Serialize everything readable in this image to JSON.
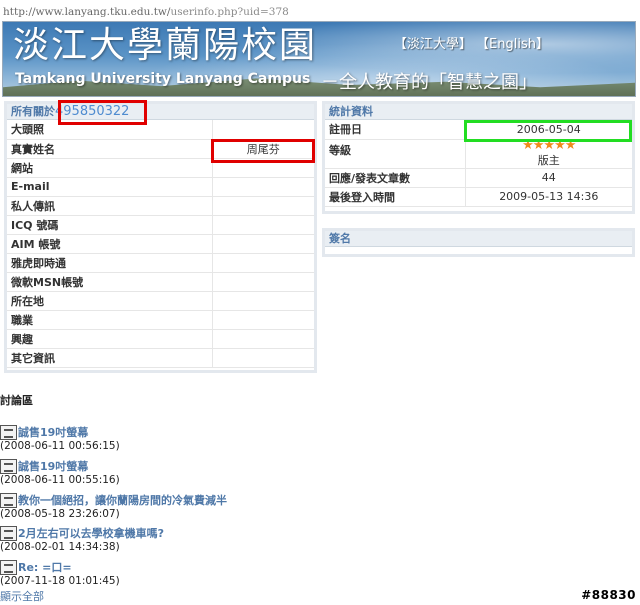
{
  "url": {
    "host": "http://www.lanyang.tku.edu.tw/",
    "path": "userinfo.php?uid=378"
  },
  "banner": {
    "title_zh": "淡江大學蘭陽校園",
    "title_en": "Tamkang University Lanyang Campus",
    "slogan": " －全人教育的「智慧之園」",
    "lang_zh": "【淡江大學】",
    "lang_en": "【English】"
  },
  "profile": {
    "header_prefix": "所有關於",
    "uid": "495850322",
    "rows": [
      {
        "label": "大頭照",
        "value": ""
      },
      {
        "label": "真實姓名",
        "value": "周尾芬"
      },
      {
        "label": "網站",
        "value": ""
      },
      {
        "label": "E-mail",
        "value": ""
      },
      {
        "label": "私人傳訊",
        "value": ""
      },
      {
        "label": "ICQ 號碼",
        "value": ""
      },
      {
        "label": "AIM 帳號",
        "value": ""
      },
      {
        "label": "雅虎即時通",
        "value": ""
      },
      {
        "label": "微軟MSN帳號",
        "value": ""
      },
      {
        "label": "所在地",
        "value": ""
      },
      {
        "label": "職業",
        "value": ""
      },
      {
        "label": "興趣",
        "value": ""
      },
      {
        "label": "其它資訊",
        "value": ""
      }
    ]
  },
  "stats": {
    "header": "統計資料",
    "register_label": "註冊日",
    "register_value": "2006-05-04",
    "rank_label": "等級",
    "rank_stars": "★★★★★",
    "rank_value": "版主",
    "posts_label": "回應/發表文章數",
    "posts_value": "44",
    "last_login_label": "最後登入時間",
    "last_login_value": "2009-05-13 14:36"
  },
  "signature": {
    "header": "簽名"
  },
  "discussion": {
    "title": "討論區",
    "topics": [
      {
        "title": "誠售19吋螢幕",
        "date": "(2008-06-11 00:56:15)"
      },
      {
        "title": "誠售19吋螢幕",
        "date": "(2008-06-11 00:55:16)"
      },
      {
        "title": "教你一個絕招，讓你蘭陽房間的冷氣費減半",
        "date": "(2008-05-18 23:26:07)"
      },
      {
        "title": "2月左右可以去學校拿機車嗎?",
        "date": "(2008-02-01 14:34:38)"
      },
      {
        "title": "Re: =口=",
        "date": "(2007-11-18 01:01:45)"
      }
    ],
    "show_all": "顯示全部"
  },
  "watermark": "#88830",
  "colors": {
    "link": "#4f78a8",
    "highlight_red": "#e00000",
    "highlight_green": "#22dd22",
    "star": "#f08a1c"
  }
}
